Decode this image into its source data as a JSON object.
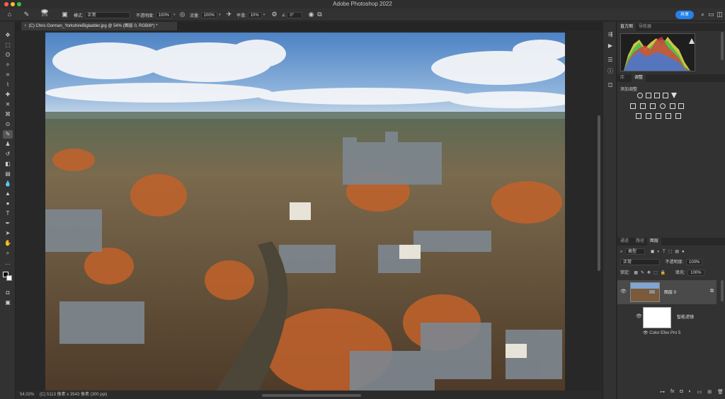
{
  "window": {
    "title": "Adobe Photoshop 2022"
  },
  "options_bar": {
    "brush_size": "275",
    "mode_label": "模式:",
    "mode_value": "正常",
    "opacity_label": "不透明度:",
    "opacity_value": "100%",
    "flow_label": "流量:",
    "flow_value": "100%",
    "smoothing_label": "平滑:",
    "smoothing_value": "10%",
    "angle_value": "0°",
    "share_label": "共享"
  },
  "document": {
    "tab_title": "(C) Chris Gorman_YorkshireBigladder.jpg @ 54% (图层 0, RGB/8*) *",
    "zoom": "54.02%",
    "status": "(C) 5113 像素 x 3543 像素 (300 ppi)"
  },
  "panels": {
    "top_tabs": [
      "直方图",
      "导航器"
    ],
    "middle_tabs": [
      "库",
      "调整"
    ],
    "adjustments_title": "添加调整",
    "layer_tabs": [
      "通道",
      "路径",
      "图层"
    ],
    "kind_label": "类型",
    "blend_mode": "正常",
    "opacity_label": "不透明度:",
    "opacity_value": "100%",
    "lock_label": "锁定:",
    "fill_label": "填充:",
    "fill_value": "100%",
    "layer_name": "图层 0",
    "smart_filters_label": "智能滤镜",
    "filter_name": "Color Efex Pro 5"
  },
  "colors": {
    "accent": "#2680eb",
    "panel_bg": "#323232",
    "canvas_bg": "#282828"
  },
  "icons": [
    "move-icon",
    "marquee-icon",
    "lasso-icon",
    "magic-wand-icon",
    "crop-icon",
    "eyedropper-icon",
    "healing-icon",
    "brush-icon",
    "stamp-icon",
    "history-brush-icon",
    "eraser-icon",
    "gradient-icon",
    "blur-icon",
    "dodge-icon",
    "pen-icon",
    "type-icon",
    "path-select-icon",
    "shape-icon",
    "hand-icon",
    "zoom-icon"
  ]
}
